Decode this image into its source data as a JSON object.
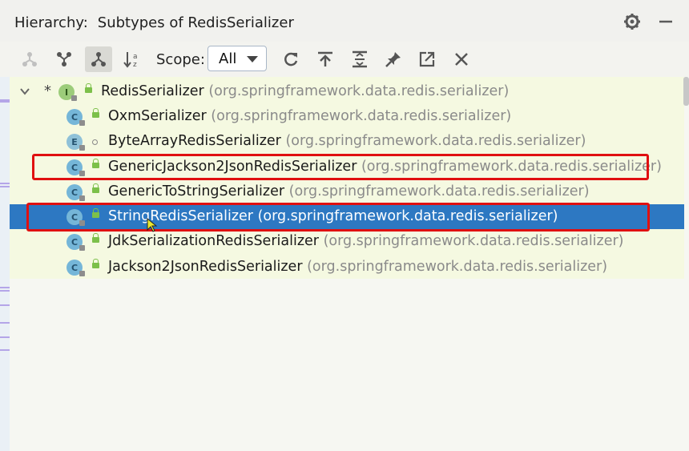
{
  "header": {
    "label": "Hierarchy:",
    "title": "Subtypes of RedisSerializer",
    "settings_icon": "gear-icon",
    "minimize_icon": "minimize-icon"
  },
  "toolbar": {
    "buttons": [
      {
        "icon": "supertypes-hierarchy-icon",
        "active": false,
        "disabled": true
      },
      {
        "icon": "type-hierarchy-icon",
        "active": false
      },
      {
        "icon": "subtypes-hierarchy-icon",
        "active": true
      },
      {
        "icon": "sort-alphabetically-icon",
        "active": false
      },
      {
        "icon": "refresh-icon",
        "active": false
      },
      {
        "icon": "scroll-to-source-icon",
        "active": false
      },
      {
        "icon": "expand-all-icon",
        "active": false
      },
      {
        "icon": "pin-icon",
        "active": false
      },
      {
        "icon": "export-icon",
        "active": false
      },
      {
        "icon": "close-icon",
        "active": false
      }
    ],
    "scope_label": "Scope:",
    "scope_value": "All"
  },
  "tree": {
    "root": {
      "star": "*",
      "icon_letter": "I",
      "name": "RedisSerializer",
      "package": "(org.springframework.data.redis.serializer)"
    },
    "children": [
      {
        "icon_letter": "C",
        "name": "OxmSerializer",
        "package": "(org.springframework.data.redis.serializer)",
        "selected": false,
        "highlighted": false
      },
      {
        "icon_letter": "E",
        "name": "ByteArrayRedisSerializer",
        "package": "(org.springframework.data.redis.serializer)",
        "selected": false,
        "highlighted": false
      },
      {
        "icon_letter": "C",
        "name": "GenericJackson2JsonRedisSerializer",
        "package": "(org.springframework.data.redis.serializer)",
        "selected": false,
        "highlighted": true
      },
      {
        "icon_letter": "C",
        "name": "GenericToStringSerializer",
        "package": "(org.springframework.data.redis.serializer)",
        "selected": false,
        "highlighted": false
      },
      {
        "icon_letter": "C",
        "name": "StringRedisSerializer",
        "package": "(org.springframework.data.redis.serializer)",
        "selected": true,
        "highlighted": true
      },
      {
        "icon_letter": "C",
        "name": "JdkSerializationRedisSerializer",
        "package": "(org.springframework.data.redis.serializer)",
        "selected": false,
        "highlighted": false
      },
      {
        "icon_letter": "C",
        "name": "Jackson2JsonRedisSerializer",
        "package": "(org.springframework.data.redis.serializer)",
        "selected": false,
        "highlighted": false
      }
    ]
  },
  "colors": {
    "selection": "#2d78c2",
    "highlight_border": "#e01010",
    "tree_background": "#f5f9e1"
  }
}
